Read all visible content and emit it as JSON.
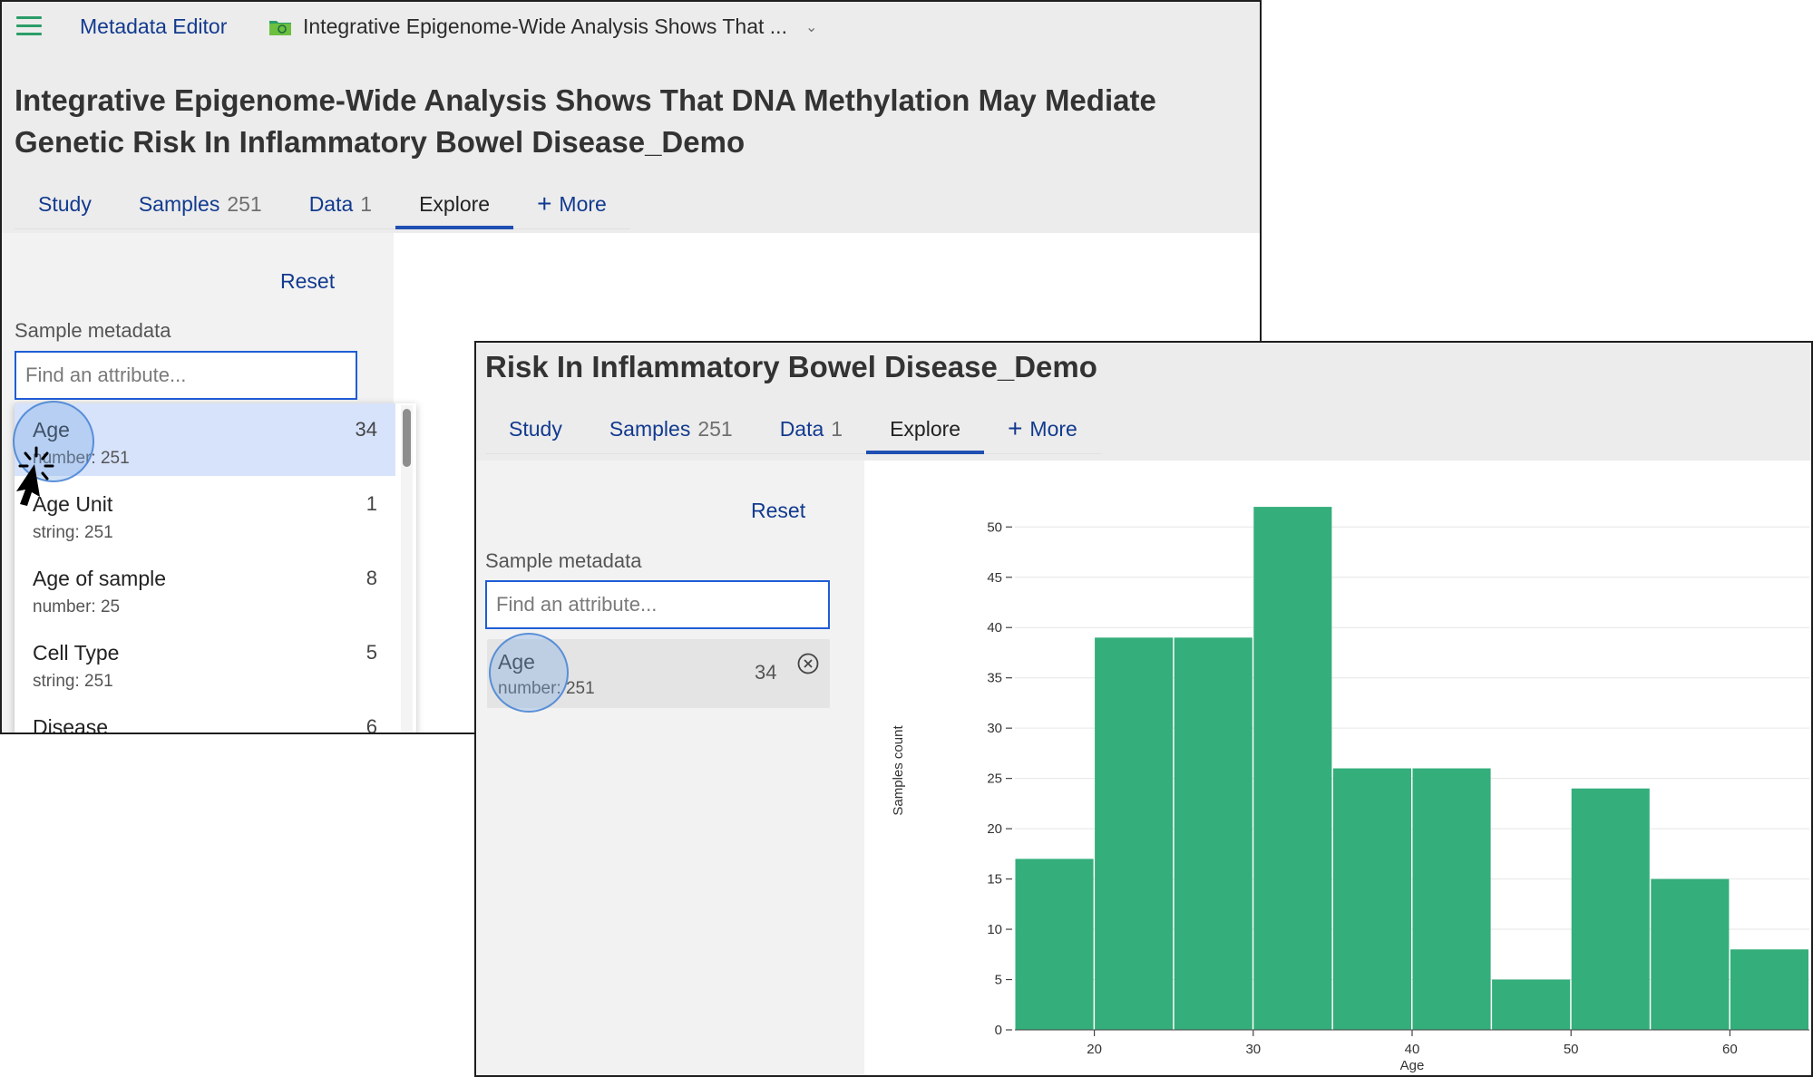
{
  "app": {
    "name": "Metadata Editor",
    "breadcrumb_title": "Integrative Epigenome-Wide Analysis Shows That ...",
    "accent_green": "#2a9d68",
    "link_blue": "#123a8f"
  },
  "window1": {
    "title": "Integrative Epigenome-Wide Analysis Shows That DNA Methylation May Mediate Genetic Risk In Inflammatory Bowel Disease_Demo",
    "tabs": [
      {
        "label": "Study",
        "count": ""
      },
      {
        "label": "Samples",
        "count": "251"
      },
      {
        "label": "Data",
        "count": "1"
      },
      {
        "label": "Explore",
        "count": ""
      },
      {
        "label": "More",
        "count": ""
      }
    ],
    "reset_label": "Reset",
    "sample_metadata_label": "Sample metadata",
    "search_placeholder": "Find an attribute...",
    "attributes": [
      {
        "name": "Age",
        "type": "number: 251",
        "count": "34",
        "selected": true
      },
      {
        "name": "Age Unit",
        "type": "string: 251",
        "count": "1"
      },
      {
        "name": "Age of sample",
        "type": "number: 25",
        "count": "8"
      },
      {
        "name": "Cell Type",
        "type": "string: 251",
        "count": "5"
      },
      {
        "name": "Disease",
        "type": "",
        "count": "6"
      }
    ]
  },
  "window2": {
    "title_visible": "Risk In Inflammatory Bowel Disease_Demo",
    "tabs": [
      {
        "label": "Study",
        "count": ""
      },
      {
        "label": "Samples",
        "count": "251"
      },
      {
        "label": "Data",
        "count": "1"
      },
      {
        "label": "Explore",
        "count": ""
      },
      {
        "label": "More",
        "count": ""
      }
    ],
    "reset_label": "Reset",
    "sample_metadata_label": "Sample metadata",
    "search_placeholder": "Find an attribute...",
    "selected_attribute": {
      "name": "Age",
      "type": "number: 251",
      "count": "34"
    }
  },
  "chart_data": {
    "type": "bar",
    "xlabel": "Age",
    "ylabel": "Samples count",
    "bin_edges": [
      15,
      20,
      25,
      30,
      35,
      40,
      45,
      50,
      55,
      60,
      65
    ],
    "values": [
      17,
      39,
      39,
      52,
      26,
      26,
      5,
      24,
      15,
      8
    ],
    "xticks": [
      20,
      30,
      40,
      50,
      60
    ],
    "yticks": [
      0,
      5,
      10,
      15,
      20,
      25,
      30,
      35,
      40,
      45,
      50
    ],
    "xlim": [
      15,
      65
    ],
    "ylim": [
      0,
      53
    ],
    "grid": "horizontal",
    "bar_color": "#34ae7b"
  }
}
